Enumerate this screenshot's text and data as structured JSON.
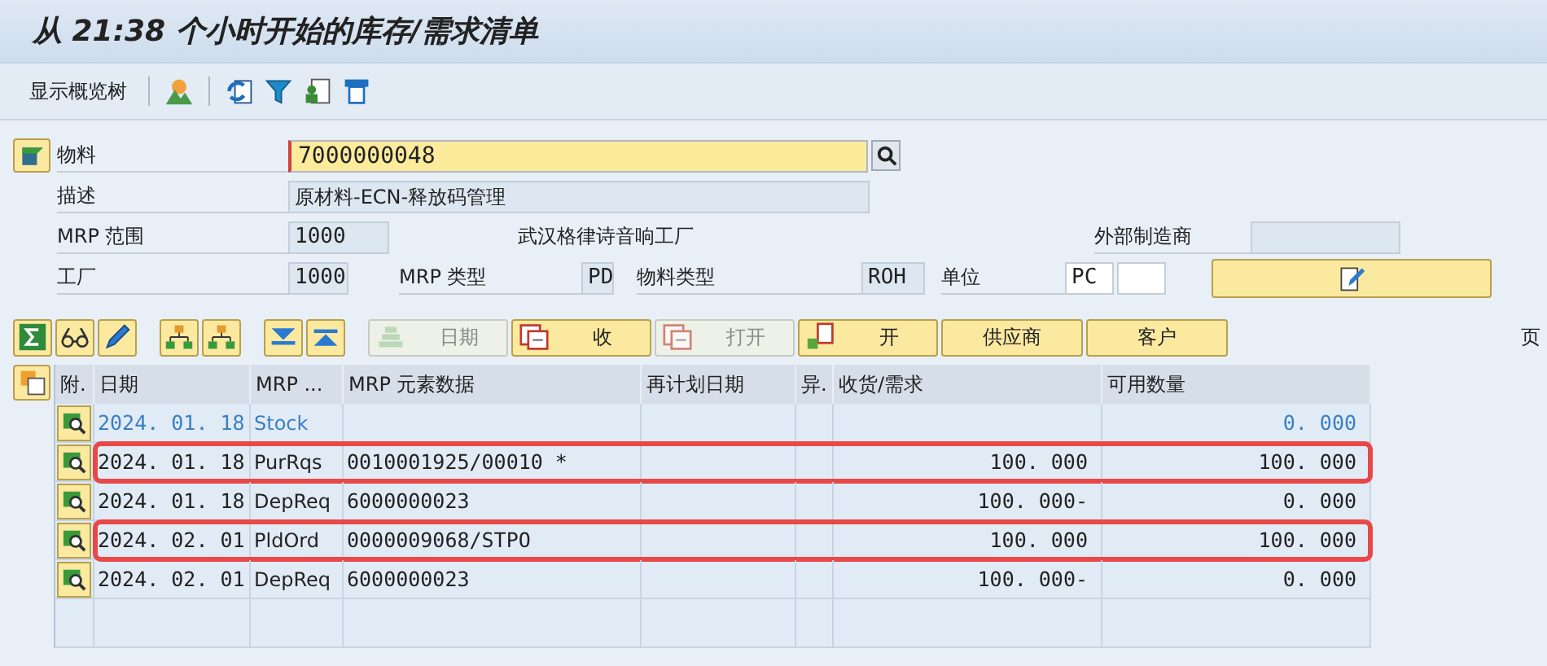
{
  "window": {
    "title": "从 21:38 个小时开始的库存/需求清单"
  },
  "toolbar": {
    "items": [
      {
        "kind": "text",
        "label": "显示概览树"
      },
      {
        "kind": "icon"
      },
      {
        "kind": "icon"
      },
      {
        "kind": "icon"
      },
      {
        "kind": "icon"
      },
      {
        "kind": "icon"
      }
    ]
  },
  "header": {
    "material": {
      "label": "物料",
      "value": "7000000048"
    },
    "description": {
      "label": "描述",
      "value": "原材料-ECN-释放码管理"
    },
    "mrp_area": {
      "label": "MRP 范围",
      "value": "1000",
      "name": "武汉格律诗音响工厂"
    },
    "external_manufacturer": {
      "label": "外部制造商"
    },
    "plant": {
      "label": "工厂",
      "value": "1000"
    },
    "mrp_type": {
      "label": "MRP 类型",
      "value": "PD"
    },
    "material_type": {
      "label": "物料类型",
      "value": "ROH"
    },
    "unit": {
      "label": "单位",
      "value": "PC"
    }
  },
  "action_bar": {
    "buttons": [
      {
        "kind": "icon",
        "disabled": false
      },
      {
        "kind": "icon",
        "disabled": false
      },
      {
        "kind": "icon",
        "disabled": false
      },
      {
        "kind": "icon",
        "disabled": false
      },
      {
        "kind": "icon",
        "disabled": false
      },
      {
        "kind": "icon",
        "disabled": false
      },
      {
        "kind": "icon",
        "disabled": false
      },
      {
        "kind": "labeled",
        "label": "日期",
        "disabled": true
      },
      {
        "kind": "labeled",
        "label": "收",
        "disabled": false
      },
      {
        "kind": "labeled",
        "label": "打开",
        "disabled": true
      },
      {
        "kind": "labeled",
        "label": "开",
        "disabled": false
      },
      {
        "kind": "text",
        "label": "供应商",
        "disabled": false
      },
      {
        "kind": "text",
        "label": "客户",
        "disabled": false
      }
    ],
    "page_label": "页"
  },
  "table": {
    "columns": [
      "附.",
      "日期",
      "MRP ...",
      "MRP 元素数据",
      "再计划日期",
      "异.",
      "收货/需求",
      "可用数量"
    ],
    "rows": [
      {
        "kind": "stock",
        "highlighted": false,
        "date": "2024. 01. 18",
        "mrp_element": "Stock",
        "available_quantity": "0. 000"
      },
      {
        "kind": "item",
        "highlighted": true,
        "date": "2024. 01. 18",
        "mrp_element": "PurRqs",
        "element_data": "0010001925/00010 *",
        "receipt_requirement": "100. 000",
        "available_quantity": "100. 000"
      },
      {
        "kind": "item",
        "highlighted": false,
        "date": "2024. 01. 18",
        "mrp_element": "DepReq",
        "element_data": "6000000023",
        "receipt_requirement": "100. 000-",
        "available_quantity": "0. 000"
      },
      {
        "kind": "item",
        "highlighted": true,
        "date": "2024. 02. 01",
        "mrp_element": "PldOrd",
        "element_data": "0000009068/STPO",
        "receipt_requirement": "100. 000",
        "available_quantity": "100. 000"
      },
      {
        "kind": "item",
        "highlighted": false,
        "date": "2024. 02. 01",
        "mrp_element": "DepReq",
        "element_data": "6000000023",
        "receipt_requirement": "100. 000-",
        "available_quantity": "0. 000"
      }
    ]
  }
}
